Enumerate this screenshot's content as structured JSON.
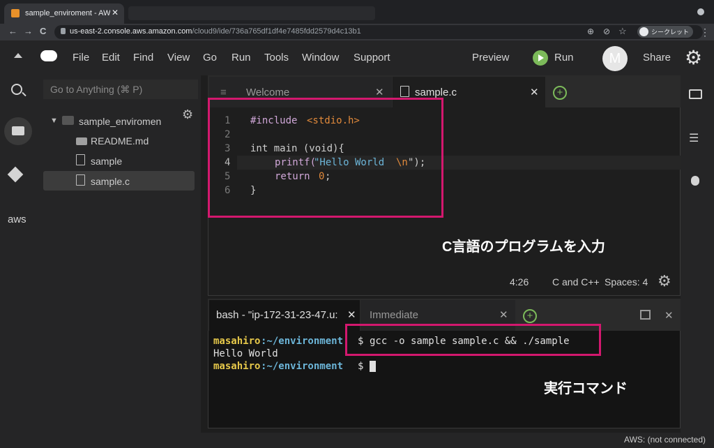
{
  "browser": {
    "tab_title": "sample_enviroment - AWS Clo",
    "tab_close": "✕",
    "back": "←",
    "forward": "→",
    "reload": "C",
    "url_host": "us-east-2.console.aws.amazon.com",
    "url_path": "/cloud9/ide/736a765df1df4e7485fdd2579d4c13b1",
    "incognito_label": "シークレット",
    "zoom_icon": "⊕",
    "eye_icon": "⊘",
    "star_icon": "☆",
    "more_icon": "⋮"
  },
  "menubar": {
    "items": [
      "File",
      "Edit",
      "Find",
      "View",
      "Go",
      "Run",
      "Tools",
      "Window",
      "Support"
    ],
    "preview": "Preview",
    "run": "Run",
    "avatar_letter": "M",
    "share": "Share"
  },
  "sidebar": {
    "goto_placeholder": "Go to Anything (⌘ P)",
    "root_folder": "sample_enviromen",
    "files": [
      "README.md",
      "sample",
      "sample.c"
    ],
    "aws_label": "aws"
  },
  "editor": {
    "tabs": [
      {
        "label": "Welcome"
      },
      {
        "label": "sample.c"
      }
    ],
    "line_numbers": [
      "1",
      "2",
      "3",
      "4",
      "5",
      "6"
    ],
    "code": {
      "l1_kw": "#include",
      "l1_rest": "<stdio.h>",
      "l3": "int main (void){",
      "l4_fn": "printf(",
      "l4_str": "\"Hello World",
      "l4_esc": "\\n",
      "l4_end": "\");",
      "l5_kw": "return",
      "l5_num": "0",
      "l5_end": ";",
      "l6": "}"
    },
    "annotation": "C言語のプログラムを入力",
    "status": {
      "position": "4:26",
      "language": "C and C++",
      "spaces": "Spaces: 4"
    }
  },
  "terminal": {
    "tabs": [
      {
        "label": "bash - \"ip-172-31-23-47.u:"
      },
      {
        "label": "Immediate"
      }
    ],
    "prompt_user": "masahiro",
    "prompt_path": ":~/environment",
    "prompt_symbol": "$",
    "command": "gcc -o sample sample.c && ./sample",
    "output": "Hello World",
    "annotation": "実行コマンド"
  },
  "footer": {
    "aws_status": "AWS: (not connected)"
  },
  "colors": {
    "accent_green": "#7cba5a",
    "highlight_box": "#d3186e",
    "keyword": "#d0a7d8",
    "string": "#6cb5d8",
    "number": "#e0893b"
  }
}
